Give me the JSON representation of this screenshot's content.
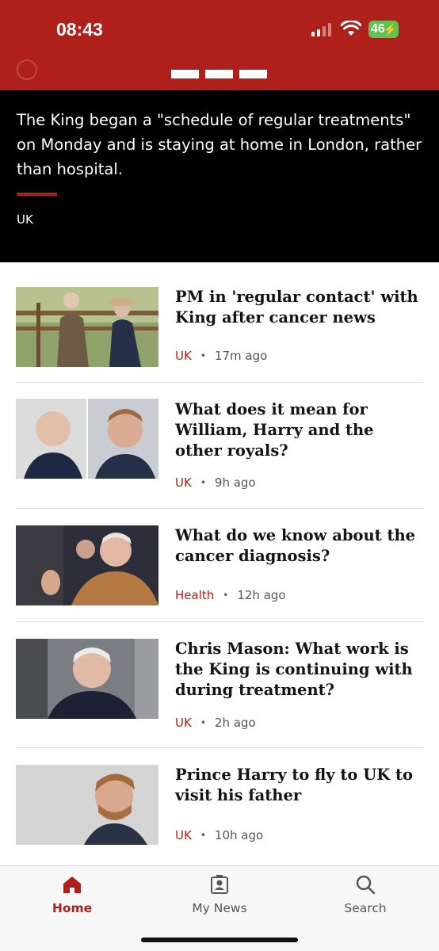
{
  "status_bar": {
    "time": "08:43",
    "battery": "46"
  },
  "hero": {
    "summary": "The King began a \"schedule of regular treatments\" on Monday and is staying at home in London, rather than hospital.",
    "tag": "UK"
  },
  "stories": [
    {
      "headline": "PM in 'regular contact' with King after cancer news",
      "tag": "UK",
      "time": "17m ago"
    },
    {
      "headline": "What does it mean for William, Harry and the other royals?",
      "tag": "UK",
      "time": "9h ago"
    },
    {
      "headline": "What do we know about the cancer diagnosis?",
      "tag": "Health",
      "time": "12h ago"
    },
    {
      "headline": "Chris Mason: What work is the King is continuing with during treatment?",
      "tag": "UK",
      "time": "2h ago"
    },
    {
      "headline": "Prince Harry to fly to UK to visit his father",
      "tag": "UK",
      "time": "10h ago"
    }
  ],
  "tabs": [
    {
      "label": "Home",
      "icon": "home-icon",
      "active": true
    },
    {
      "label": "My News",
      "icon": "my-news-icon",
      "active": false
    },
    {
      "label": "Search",
      "icon": "search-icon",
      "active": false
    }
  ],
  "colors": {
    "brand_red": "#b0201a",
    "hero_bg": "#000000",
    "battery_green": "#5fc34f"
  }
}
